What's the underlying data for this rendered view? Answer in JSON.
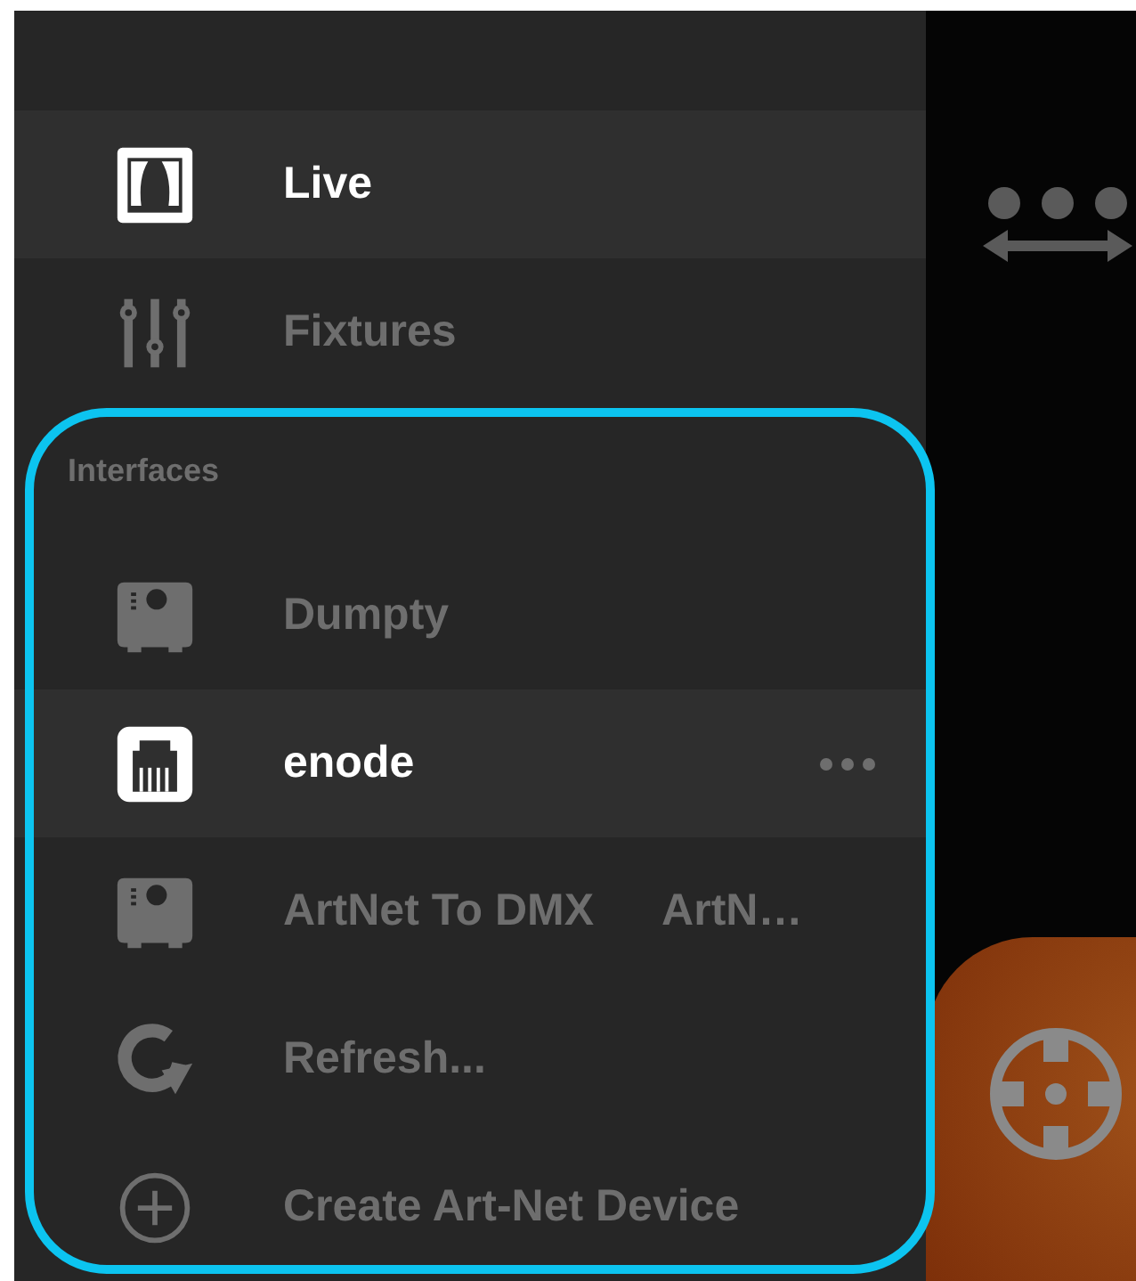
{
  "drawer": {
    "items": [
      {
        "kind": "curtain",
        "label": "Live",
        "selected": true
      },
      {
        "kind": "sliders",
        "label": "Fixtures",
        "selected": false
      }
    ],
    "section": {
      "title": "Interfaces",
      "items": [
        {
          "kind": "box",
          "label": "Dumpty",
          "selected": false
        },
        {
          "kind": "ethernet",
          "label": "enode",
          "selected": true,
          "menu": true
        },
        {
          "kind": "box",
          "label": "ArtNet To DMX",
          "detail": "ArtN…",
          "selected": false
        },
        {
          "kind": "refresh",
          "label": "Refresh...",
          "selected": false
        },
        {
          "kind": "plus",
          "label": "Create Art-Net Device",
          "selected": false
        }
      ]
    }
  }
}
